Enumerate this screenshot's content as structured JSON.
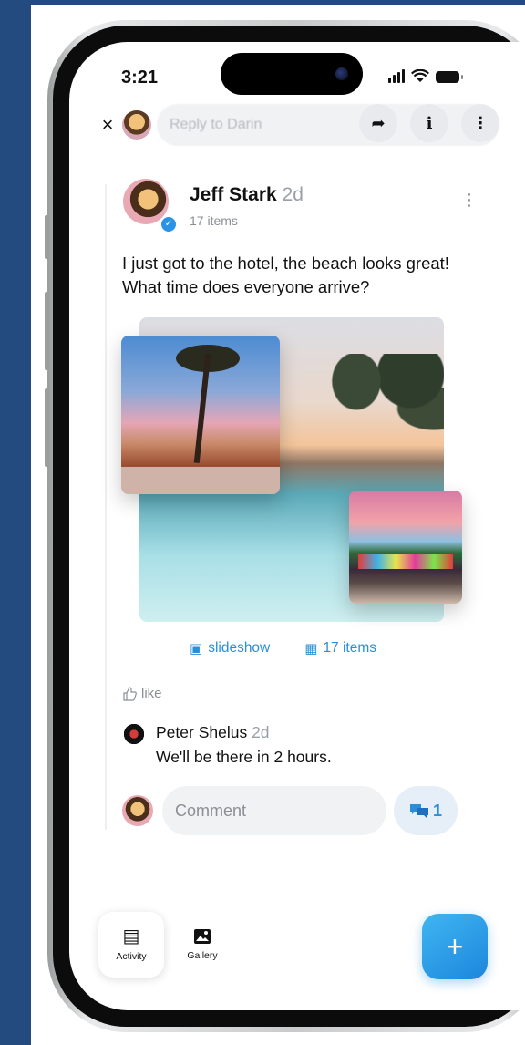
{
  "status_bar": {
    "time": "3:21"
  },
  "reply_bar": {
    "close_glyph": "×",
    "placeholder": "Reply to Darin",
    "share_glyph": "➦",
    "info_glyph": "i",
    "more_glyph": "⋮"
  },
  "post": {
    "author": "Jeff Stark",
    "age": "2d",
    "items_count": "17 items",
    "text": "I just got to the hotel, the beach looks great! What time does everyone arrive?",
    "more_glyph": "⋮",
    "slideshow_label": "slideshow",
    "items_link": "17 items",
    "like_label": "like"
  },
  "comment": {
    "author": "Peter Shelus",
    "age": "2d",
    "text": "We'll be there in 2 hours."
  },
  "composer": {
    "placeholder": "Comment",
    "comment_count": "1"
  },
  "tab_bar": {
    "activity_label": "Activity",
    "gallery_label": "Gallery",
    "fab_glyph": "+"
  },
  "colors": {
    "accent": "#2a8fd8",
    "frame_band": "#234b80",
    "fab": "#1d86dc"
  },
  "icons": {
    "share": "share-arrow-icon",
    "info": "info-icon",
    "more": "more-vertical-icon",
    "slideshow": "slideshow-icon",
    "grid": "grid-icon",
    "like": "thumbs-up-icon",
    "comments": "comments-icon",
    "activity": "newspaper-icon",
    "gallery": "image-icon"
  }
}
